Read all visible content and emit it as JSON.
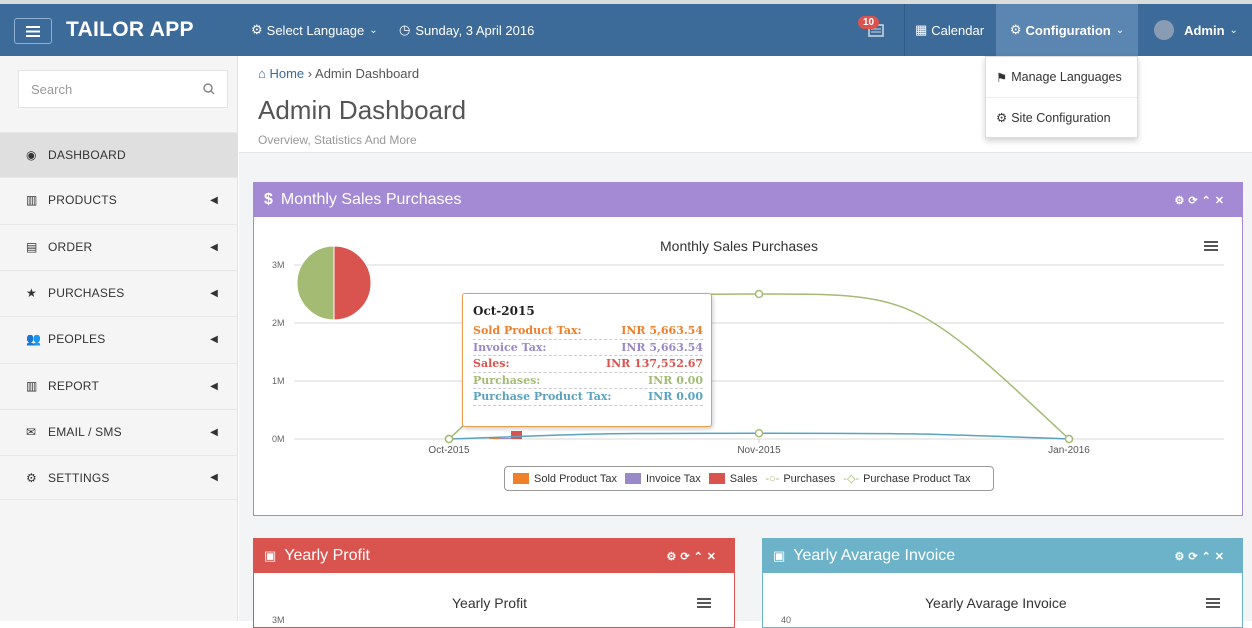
{
  "app": {
    "title": "TAILOR APP"
  },
  "topnav": {
    "language": "Select Language",
    "date": "Sunday, 3 April 2016",
    "notification_count": "10",
    "calendar": "Calendar",
    "configuration": "Configuration",
    "user": "Admin"
  },
  "config_menu": {
    "items": [
      {
        "label": "Manage Languages",
        "icon": "flag-icon"
      },
      {
        "label": "Site Configuration",
        "icon": "gear-icon"
      }
    ]
  },
  "sidebar": {
    "search_placeholder": "Search",
    "items": [
      {
        "label": "DASHBOARD",
        "icon": "dashboard-icon"
      },
      {
        "label": "PRODUCTS",
        "icon": "barcode-icon"
      },
      {
        "label": "ORDER",
        "icon": "list-icon"
      },
      {
        "label": "PURCHASES",
        "icon": "star-icon"
      },
      {
        "label": "PEOPLES",
        "icon": "users-icon"
      },
      {
        "label": "REPORT",
        "icon": "barcode-icon"
      },
      {
        "label": "EMAIL / SMS",
        "icon": "envelope-icon"
      },
      {
        "label": "SETTINGS",
        "icon": "gears-icon"
      }
    ]
  },
  "breadcrumb": {
    "home": "Home",
    "current": "Admin Dashboard"
  },
  "page": {
    "title": "Admin Dashboard",
    "subtitle": "Overview, Statistics And More"
  },
  "panels": {
    "monthly": {
      "header": "Monthly Sales Purchases",
      "color": "#a48ad4"
    },
    "profit": {
      "header": "Yearly Profit",
      "chart_title": "Yearly Profit",
      "color": "#d9534f",
      "first_tick": "3M"
    },
    "invoice": {
      "header": "Yearly Avarage Invoice",
      "chart_title": "Yearly Avarage Invoice",
      "color": "#6cb3c9",
      "first_tick": "40"
    }
  },
  "tooltip": {
    "header": "Oct-2015",
    "rows": [
      {
        "label": "Sold Product Tax:",
        "value": "INR 5,663.54",
        "color": "#f07f2a"
      },
      {
        "label": "Invoice Tax:",
        "value": "INR 5,663.54",
        "color": "#9a89c9"
      },
      {
        "label": "Sales:",
        "value": "INR 137,552.67",
        "color": "#d9534f"
      },
      {
        "label": "Purchases:",
        "value": "INR 0.00",
        "color": "#a3bb73"
      },
      {
        "label": "Purchase Product Tax:",
        "value": "INR 0.00",
        "color": "#5aa3c0"
      }
    ]
  },
  "chart_data": [
    {
      "type": "bar",
      "title": "Monthly Sales Purchases",
      "categories": [
        "Oct-2015",
        "Nov-2015",
        "Jan-2016"
      ],
      "y_ticks": [
        "0M",
        "1M",
        "2M",
        "3M"
      ],
      "ylim": [
        0,
        3000000
      ],
      "grid": true,
      "legend": "bottom",
      "series": [
        {
          "name": "Sold Product Tax",
          "type": "bar",
          "color": "#f07f2a",
          "values": [
            5663.54,
            0,
            0
          ]
        },
        {
          "name": "Invoice Tax",
          "type": "bar",
          "color": "#9a89c9",
          "values": [
            5663.54,
            0,
            0
          ]
        },
        {
          "name": "Sales",
          "type": "bar",
          "color": "#d9534f",
          "values": [
            137552.67,
            0,
            0
          ]
        },
        {
          "name": "Purchases",
          "type": "line",
          "color": "#a3bb73",
          "values": [
            0,
            2500000,
            0
          ]
        },
        {
          "name": "Purchase Product Tax",
          "type": "line",
          "color": "#5aa3c0",
          "values": [
            0,
            100000,
            0
          ]
        }
      ],
      "pie": {
        "type": "pie",
        "slices": [
          {
            "value": 50,
            "color": "#d9534f"
          },
          {
            "value": 50,
            "color": "#a3bb73"
          }
        ]
      }
    }
  ]
}
